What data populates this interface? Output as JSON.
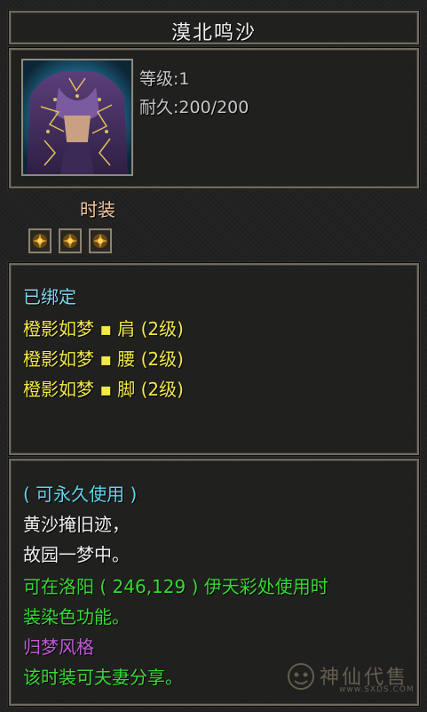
{
  "item": {
    "name": "漠北鸣沙",
    "level_label": "等级",
    "level_sep": ":",
    "level_value": "1",
    "durability_label": "耐久",
    "durability_sep": ":",
    "durability_value": "200/200",
    "type": "时装",
    "gem_slots": [
      "gem-icon",
      "gem-icon",
      "gem-icon"
    ]
  },
  "bind": {
    "status": "已绑定",
    "set_items": [
      "橙影如梦 ▪ 肩 (2级)",
      "橙影如梦 ▪ 腰 (2级)",
      "橙影如梦 ▪ 脚 (2级)"
    ]
  },
  "description": {
    "usage": "( 可永久使用 )",
    "poem_line1": "黄沙掩旧迹，",
    "poem_line2": "故园一梦中。",
    "dye_line1": "可在洛阳 ( 246,129 ) 伊天彩处使用时",
    "dye_line2": "装染色功能。",
    "style": "归梦风格",
    "share": "该时装可夫妻分享。"
  },
  "watermark": {
    "text": "神仙代售",
    "url": "www.SXDS.COM"
  },
  "colors": {
    "title": "#f2f2f2",
    "info": "#c8c8c8",
    "type": "#f2c6a0",
    "bind_status": "#7fd6ee",
    "set_item": "#f2e94a",
    "usage": "#5fd6ea",
    "poem": "#f0f0f0",
    "dye": "#38d934",
    "style": "#c05bd6",
    "share": "#38d934"
  }
}
